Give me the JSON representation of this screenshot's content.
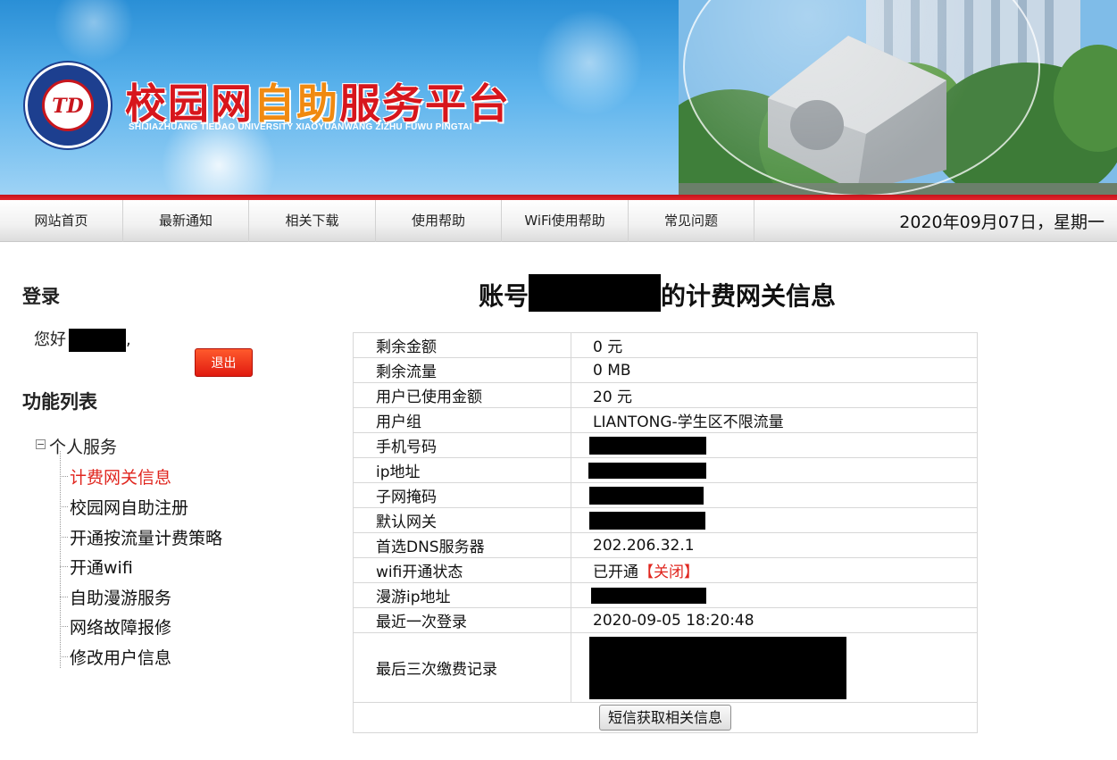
{
  "header": {
    "title_part1": "校园网",
    "title_part2": "自助",
    "title_part3": "服务平台",
    "subtitle": "SHIJIAZHUANG TIEDAO UNIVERSITY XIAOYUANWANG ZIZHU FUWU PINGTAI",
    "logo_monogram": "TD",
    "colors": {
      "title_red": "#d7161c",
      "title_orange": "#f08a10",
      "sky_blue": "#3a9ae0",
      "accent_red": "#d0161d"
    }
  },
  "nav": {
    "items": [
      "网站首页",
      "最新通知",
      "相关下载",
      "使用帮助",
      "WiFi使用帮助",
      "常见问题"
    ],
    "date": "2020年09月07日，星期一"
  },
  "sidebar": {
    "login_heading": "登录",
    "greeting": "您好",
    "greeting_suffix": ",",
    "logout_label": "退出",
    "function_heading": "功能列表",
    "tree_root": "个人服务",
    "tree_toggle": "−",
    "items": [
      "计费网关信息",
      "校园网自助注册",
      "开通按流量计费策略",
      "开通wifi",
      "自助漫游服务",
      "网络故障报修",
      "修改用户信息"
    ],
    "active_item": "计费网关信息"
  },
  "main": {
    "title_prefix": "账号",
    "title_suffix": "的计费网关信息",
    "rows": [
      {
        "label": "剩余金额",
        "value": "0 元"
      },
      {
        "label": "剩余流量",
        "value": "0 MB"
      },
      {
        "label": "用户已使用金额",
        "value": "20 元"
      },
      {
        "label": "用户组",
        "value": "LIANTONG-学生区不限流量"
      },
      {
        "label": "手机号码",
        "value": "",
        "redacted": true
      },
      {
        "label": "ip地址",
        "value": "",
        "redacted": true
      },
      {
        "label": "子网掩码",
        "value": "",
        "redacted": true
      },
      {
        "label": "默认网关",
        "value": "",
        "redacted": true
      },
      {
        "label": "首选DNS服务器",
        "value": "202.206.32.1"
      },
      {
        "label": "wifi开通状态",
        "value": "已开通",
        "link": "【关闭】"
      },
      {
        "label": "漫游ip地址",
        "value": "",
        "redacted": true
      },
      {
        "label": "最近一次登录",
        "value": "2020-09-05 18:20:48"
      },
      {
        "label": "最后三次缴费记录",
        "value": "",
        "redacted": true
      }
    ],
    "sms_button": "短信获取相关信息"
  }
}
